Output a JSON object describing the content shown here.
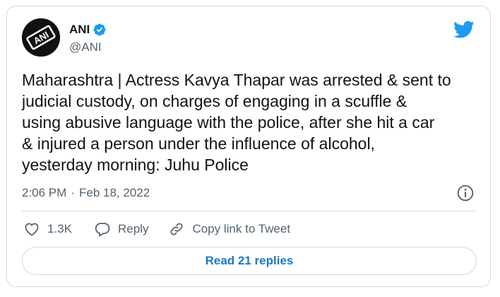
{
  "author": {
    "display_name": "ANI",
    "handle": "@ANI",
    "avatar_text": "ANI",
    "verified_icon": "verified-badge-icon"
  },
  "tweet": {
    "text": "Maharashtra | Actress Kavya Thapar was arrested & sent to\njudicial custody, on charges of engaging in a scuffle &\nusing abusive language with the police, after she hit a car\n& injured a person under the influence of alcohol,\nyesterday morning: Juhu Police",
    "time": "2:06 PM",
    "separator": "·",
    "date": "Feb 18, 2022"
  },
  "actions": {
    "like_count": "1.3K",
    "reply_label": "Reply",
    "copy_label": "Copy link to Tweet"
  },
  "read_replies_label": "Read 21 replies",
  "colors": {
    "twitter_blue": "#1d9bf0",
    "link_blue": "#1d78c1",
    "muted_text": "#536471",
    "border": "#cfd9de"
  }
}
